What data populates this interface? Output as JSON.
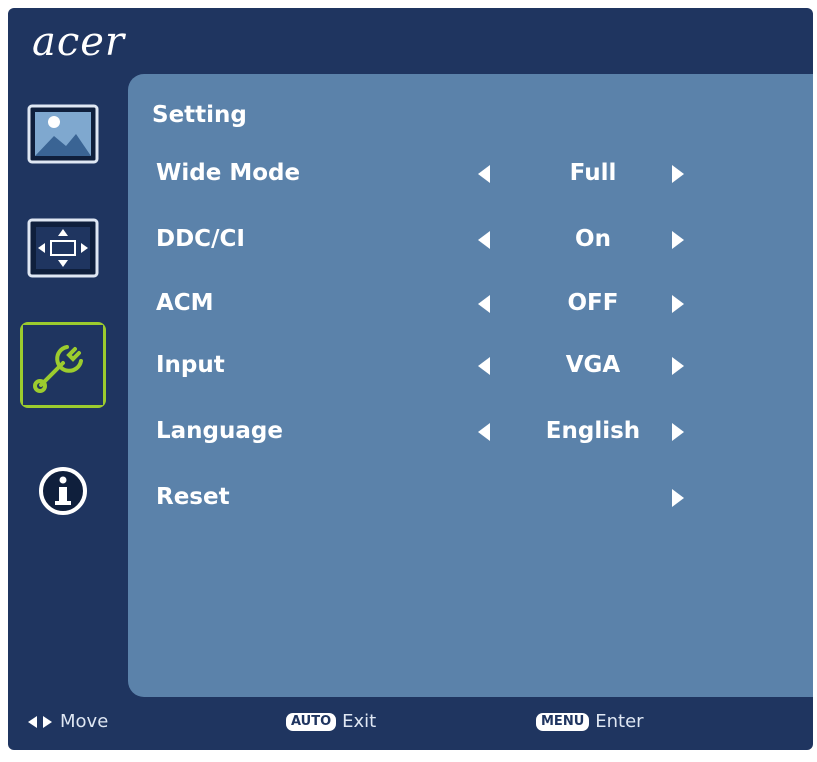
{
  "brand": {
    "logo_text": "acer"
  },
  "sidebar": {
    "items": [
      {
        "name": "picture",
        "icon": "picture-icon",
        "active": false
      },
      {
        "name": "position",
        "icon": "position-arrows-icon",
        "active": false
      },
      {
        "name": "setting",
        "icon": "wrench-setting-icon",
        "active": true
      },
      {
        "name": "information",
        "icon": "info-icon",
        "active": false
      }
    ],
    "active_color": "#9ccc2e"
  },
  "panel": {
    "title": "Setting",
    "rows": [
      {
        "label": "Wide Mode",
        "value": "Full",
        "has_left": true,
        "has_right": true
      },
      {
        "label": "DDC/CI",
        "value": "On",
        "has_left": true,
        "has_right": true
      },
      {
        "label": "ACM",
        "value": "OFF",
        "has_left": true,
        "has_right": true
      },
      {
        "label": "Input",
        "value": "VGA",
        "has_left": true,
        "has_right": true
      },
      {
        "label": "Language",
        "value": "English",
        "has_left": true,
        "has_right": true
      },
      {
        "label": "Reset",
        "value": "",
        "has_left": false,
        "has_right": true
      }
    ]
  },
  "footer": {
    "move_label": "Move",
    "auto_key": "AUTO",
    "exit_label": "Exit",
    "menu_key": "MENU",
    "enter_label": "Enter"
  },
  "colors": {
    "frame": "#1f3560",
    "panel": "#5b82aa",
    "text": "#ffffff"
  }
}
